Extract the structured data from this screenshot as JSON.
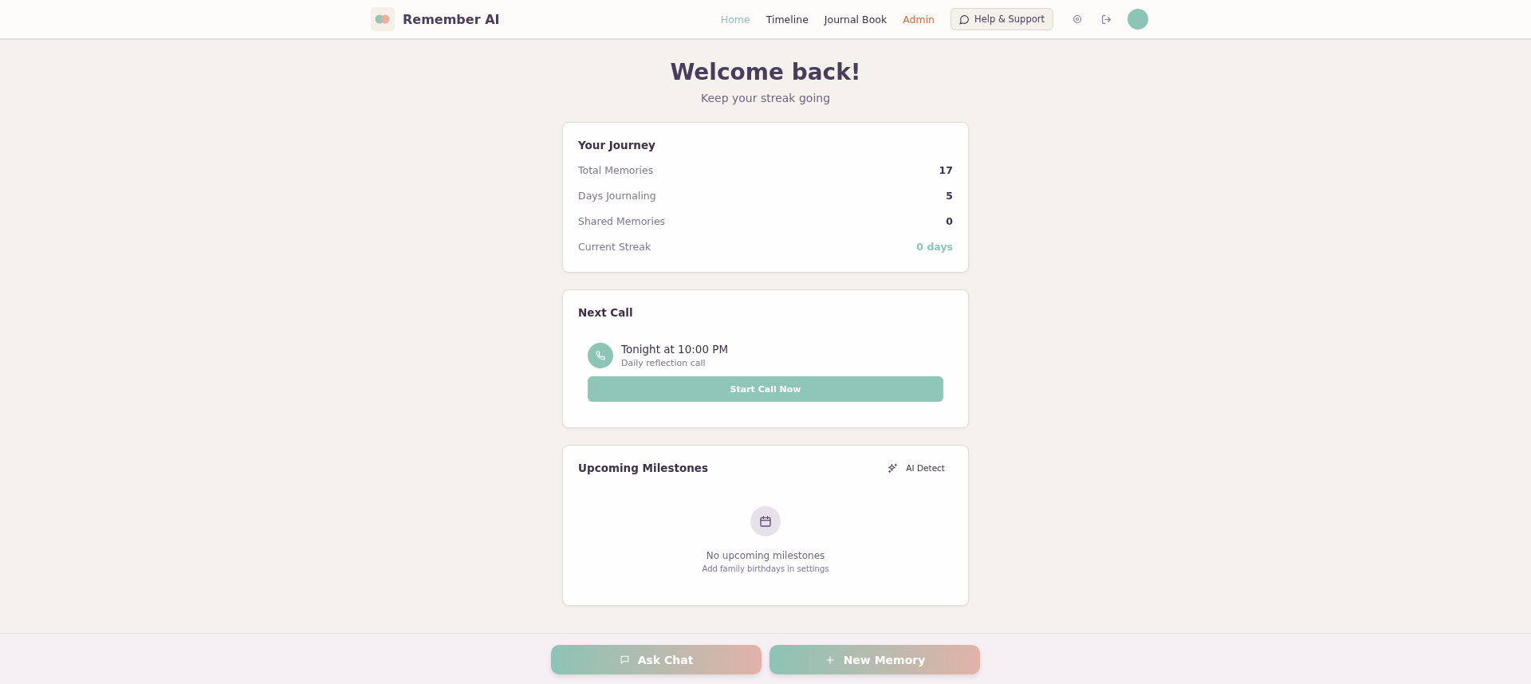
{
  "header": {
    "brand": "Remember AI",
    "nav": [
      {
        "label": "Home",
        "selected": true,
        "kind": "link"
      },
      {
        "label": "Timeline",
        "selected": false,
        "kind": "link"
      },
      {
        "label": "Journal Book",
        "selected": false,
        "kind": "link"
      },
      {
        "label": "Admin",
        "selected": false,
        "kind": "admin"
      }
    ],
    "help_button": "Help & Support"
  },
  "welcome": {
    "title": "Welcome back!",
    "subtitle": "Keep your streak going"
  },
  "journey": {
    "title": "Your Journey",
    "stats": [
      {
        "label": "Total Memories",
        "value": "17",
        "highlight": false
      },
      {
        "label": "Days Journaling",
        "value": "5",
        "highlight": false
      },
      {
        "label": "Shared Memories",
        "value": "0",
        "highlight": false
      },
      {
        "label": "Current Streak",
        "value": "0 days",
        "highlight": true
      }
    ]
  },
  "next_call": {
    "title": "Next Call",
    "time": "Tonight at 10:00 PM",
    "description": "Daily reflection call",
    "button": "Start Call Now"
  },
  "milestones": {
    "title": "Upcoming Milestones",
    "action": "AI Detect",
    "empty_title": "No upcoming milestones",
    "empty_hint": "Add family birthdays in settings"
  },
  "bottom_actions": [
    {
      "label": "Ask Chat",
      "kind": "chat"
    },
    {
      "label": "New Memory",
      "kind": "add"
    }
  ]
}
